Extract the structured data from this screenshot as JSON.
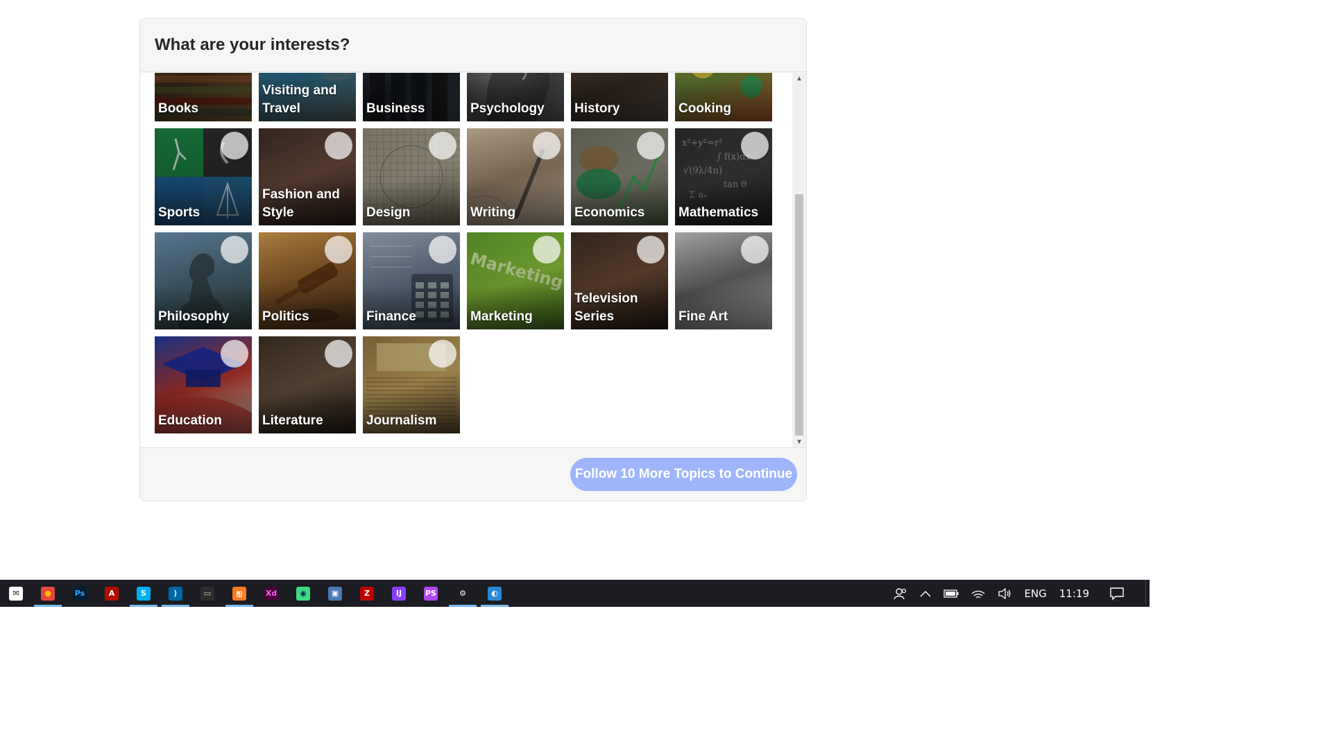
{
  "modal": {
    "title": "What are your interests?",
    "continue_label": "Follow 10 More Topics to Continue"
  },
  "topics": [
    {
      "label": "Books",
      "icon": "books-photo"
    },
    {
      "label": "Visiting and Travel",
      "icon": "travel-photo"
    },
    {
      "label": "Business",
      "icon": "business-photo"
    },
    {
      "label": "Psychology",
      "icon": "psychology-photo"
    },
    {
      "label": "History",
      "icon": "history-photo"
    },
    {
      "label": "Cooking",
      "icon": "cooking-photo"
    },
    {
      "label": "Sports",
      "icon": "sports-photo"
    },
    {
      "label": "Fashion and Style",
      "icon": "fashion-photo"
    },
    {
      "label": "Design",
      "icon": "design-photo"
    },
    {
      "label": "Writing",
      "icon": "writing-photo"
    },
    {
      "label": "Economics",
      "icon": "economics-photo"
    },
    {
      "label": "Mathematics",
      "icon": "mathematics-photo"
    },
    {
      "label": "Philosophy",
      "icon": "philosophy-photo"
    },
    {
      "label": "Politics",
      "icon": "politics-photo"
    },
    {
      "label": "Finance",
      "icon": "finance-photo"
    },
    {
      "label": "Marketing",
      "icon": "marketing-photo"
    },
    {
      "label": "Television Series",
      "icon": "television-photo"
    },
    {
      "label": "Fine Art",
      "icon": "fine-art-photo"
    },
    {
      "label": "Education",
      "icon": "education-photo"
    },
    {
      "label": "Literature",
      "icon": "literature-photo"
    },
    {
      "label": "Journalism",
      "icon": "journalism-photo"
    }
  ],
  "taskbar": {
    "apps": [
      {
        "name": "mail-icon",
        "glyph": "✉",
        "color": "#ffffff",
        "fg": "#1b1d22",
        "active": false
      },
      {
        "name": "chrome-icon",
        "glyph": "●",
        "color": "#e8453c",
        "fg": "#fbbc05",
        "active": true
      },
      {
        "name": "photoshop-icon",
        "glyph": "Ps",
        "color": "#001e36",
        "fg": "#31a8ff",
        "active": false
      },
      {
        "name": "acrobat-icon",
        "glyph": "A",
        "color": "#b30b00",
        "fg": "#ffffff",
        "active": false
      },
      {
        "name": "skype-icon",
        "glyph": "S",
        "color": "#00aff0",
        "fg": "#ffffff",
        "active": true
      },
      {
        "name": "vscode-icon",
        "glyph": "⟩",
        "color": "#0065a9",
        "fg": "#ffffff",
        "active": true
      },
      {
        "name": "terminal-icon",
        "glyph": "▭",
        "color": "#2d2d2d",
        "fg": "#cccccc",
        "active": false
      },
      {
        "name": "xampp-icon",
        "glyph": "ஐ",
        "color": "#fb7a24",
        "fg": "#ffffff",
        "active": true
      },
      {
        "name": "adobe-xd-icon",
        "glyph": "Xd",
        "color": "#470137",
        "fg": "#ff61f6",
        "active": false
      },
      {
        "name": "android-studio-icon",
        "glyph": "◉",
        "color": "#3ddc84",
        "fg": "#073042",
        "active": false
      },
      {
        "name": "remote-desktop-icon",
        "glyph": "▣",
        "color": "#4a7ab5",
        "fg": "#ffffff",
        "active": false
      },
      {
        "name": "filezilla-icon",
        "glyph": "Z",
        "color": "#bf0000",
        "fg": "#ffffff",
        "active": false
      },
      {
        "name": "intellij-icon",
        "glyph": "IJ",
        "color": "#8a3ffc",
        "fg": "#ffffff",
        "active": false
      },
      {
        "name": "phpstorm-icon",
        "glyph": "PS",
        "color": "#b345f1",
        "fg": "#ffffff",
        "active": false
      },
      {
        "name": "settings-icon",
        "glyph": "⚙",
        "color": "#1b1d22",
        "fg": "#ffffff",
        "active": true
      },
      {
        "name": "paint-icon",
        "glyph": "◐",
        "color": "#2b88d8",
        "fg": "#ffffff",
        "active": true
      }
    ],
    "tray": {
      "people_icon": "people-icon",
      "chevron_icon": "chevron-up-icon",
      "battery_icon": "battery-icon",
      "wifi_icon": "wifi-icon",
      "volume_icon": "volume-icon",
      "language": "ENG",
      "time": "11:19",
      "notifications_icon": "action-center-icon"
    }
  }
}
